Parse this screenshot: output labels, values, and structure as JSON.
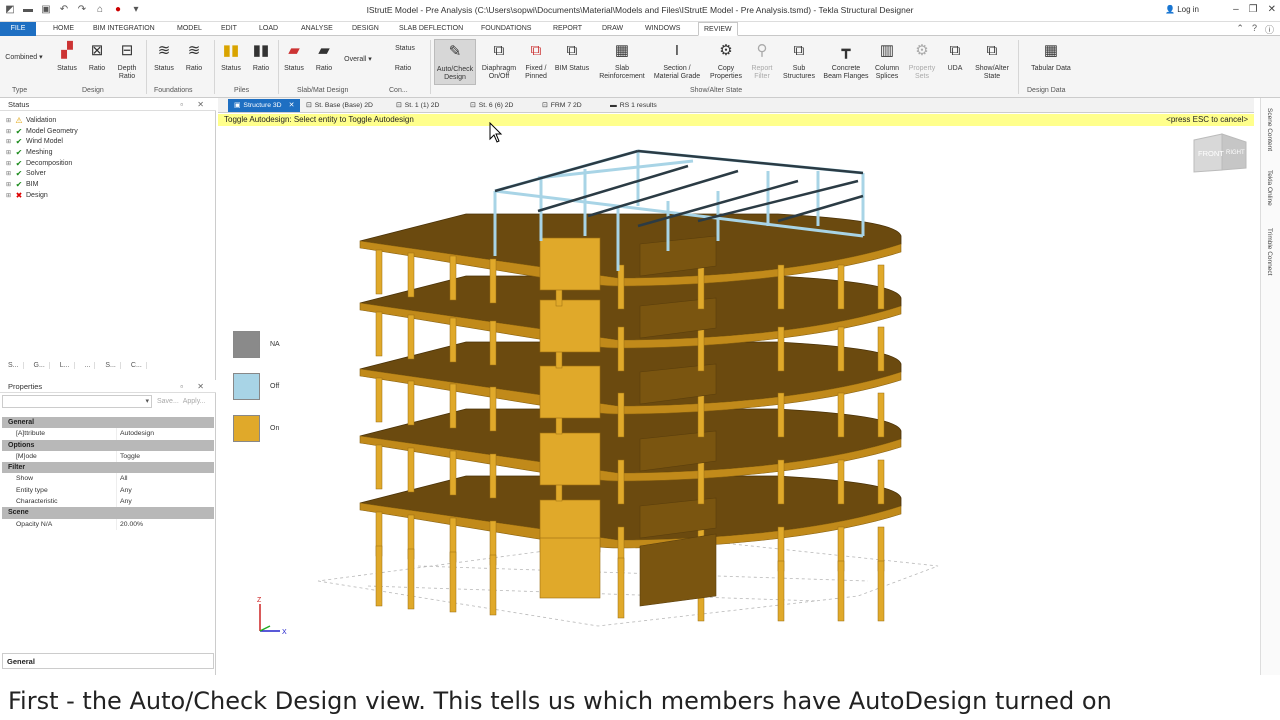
{
  "window": {
    "title": "IStrutE Model - Pre Analysis (C:\\Users\\sopwi\\Documents\\Material\\Models and Files\\IStrutE Model - Pre Analysis.tsmd) - Tekla Structural Designer",
    "login": "Log in"
  },
  "menu_tabs": [
    "FILE",
    "HOME",
    "BIM INTEGRATION",
    "MODEL",
    "EDIT",
    "LOAD",
    "ANALYSE",
    "DESIGN",
    "SLAB DEFLECTION",
    "FOUNDATIONS",
    "REPORT",
    "DRAW",
    "WINDOWS",
    "REVIEW"
  ],
  "menu_active": "REVIEW",
  "ribbon": {
    "combined": "Combined",
    "status": "Status",
    "ratio": "Ratio",
    "depth_ratio": "Depth Ratio",
    "overall": "Overall",
    "auto_check": "Auto/Check Design",
    "diaphragm": "Diaphragm On/Off",
    "fixed_pinned": "Fixed / Pinned",
    "bim_status": "BIM Status",
    "slab_reinf": "Slab Reinforcement",
    "section_grade": "Section / Material Grade",
    "copy_props": "Copy Properties",
    "report_filter": "Report Filter",
    "sub_structures": "Sub Structures",
    "concrete_flanges": "Concrete Beam Flanges",
    "column_splices": "Column Splices",
    "property_sets": "Property Sets",
    "uda": "UDA",
    "show_alter": "Show/Alter State",
    "tabular_data": "Tabular Data",
    "groups": {
      "type": "Type",
      "design": "Design",
      "foundations": "Foundations",
      "piles": "Piles",
      "slab_mat": "Slab/Mat Design",
      "con": "Con...",
      "show_alter_state": "Show/Alter State",
      "design_data": "Design Data"
    }
  },
  "status_panel": {
    "title": "Status",
    "items": [
      {
        "label": "Validation",
        "mark": "warn"
      },
      {
        "label": "Model Geometry",
        "mark": "ok"
      },
      {
        "label": "Wind Model",
        "mark": "ok"
      },
      {
        "label": "Meshing",
        "mark": "ok"
      },
      {
        "label": "Decomposition",
        "mark": "ok"
      },
      {
        "label": "Solver",
        "mark": "ok"
      },
      {
        "label": "BIM",
        "mark": "ok"
      },
      {
        "label": "Design",
        "mark": "err"
      }
    ],
    "tabs": [
      "S...",
      "G...",
      "L...",
      "...",
      "S...",
      "C..."
    ]
  },
  "properties": {
    "title": "Properties",
    "save": "Save...",
    "apply": "Apply...",
    "sections": [
      {
        "name": "General",
        "rows": [
          {
            "k": "[A]ttribute",
            "v": "Autodesign"
          }
        ]
      },
      {
        "name": "Options",
        "rows": [
          {
            "k": "[M]ode",
            "v": "Toggle"
          }
        ]
      },
      {
        "name": "Filter",
        "rows": [
          {
            "k": "Show",
            "v": "All"
          },
          {
            "k": "Entity type",
            "v": "Any"
          },
          {
            "k": "Characteristic",
            "v": "Any"
          }
        ]
      },
      {
        "name": "Scene",
        "rows": [
          {
            "k": "Opacity N/A",
            "v": "20.00%"
          }
        ]
      }
    ],
    "footer": "General"
  },
  "view_tabs": [
    "Structure 3D",
    "St. Base (Base) 2D",
    "St. 1 (1) 2D",
    "St. 6 (6) 2D",
    "FRM 7 2D",
    "RS 1 results"
  ],
  "status_message": "Toggle Autodesign: Select entity to Toggle Autodesign",
  "esc_message": "<press ESC to cancel>",
  "legend": [
    {
      "label": "NA",
      "color": "#8a8a8a"
    },
    {
      "label": "Off",
      "color": "#a8d4e6"
    },
    {
      "label": "On",
      "color": "#e0a92a"
    }
  ],
  "viewcube": {
    "front": "FRONT",
    "right": "RIGHT"
  },
  "axes": {
    "z": "Z",
    "x": "X"
  },
  "side_panels": [
    "Scene Content",
    "Tekla Online",
    "Trimble Connect"
  ],
  "caption": "First - the Auto/Check Design view. This tells us which members have AutoDesign turned on"
}
